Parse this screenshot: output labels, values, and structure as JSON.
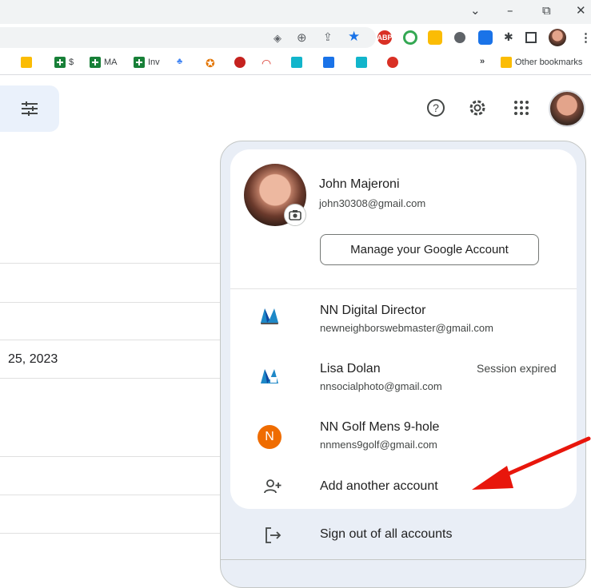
{
  "browser": {
    "window_controls": [
      "⌄",
      "–",
      "⧉",
      "✕"
    ],
    "extensions": [
      {
        "icon": "eye-icon",
        "color": "#5f6368"
      },
      {
        "icon": "zoom-icon",
        "color": "#5f6368"
      },
      {
        "icon": "share-icon",
        "color": "#5f6368"
      },
      {
        "icon": "star-icon",
        "color": "#1a73e8"
      },
      {
        "icon": "abp-extension-icon",
        "color": "#d93025",
        "label": "ABP"
      },
      {
        "icon": "compass-extension-icon",
        "color": "#34a853"
      },
      {
        "icon": "keep-extension-icon",
        "color": "#fbbc04"
      },
      {
        "icon": "settings-extension-icon",
        "color": "#5f6368"
      },
      {
        "icon": "screen-extension-icon",
        "color": "#1a73e8"
      },
      {
        "icon": "puzzle-icon",
        "color": "#3c4043"
      },
      {
        "icon": "sidepanel-icon",
        "color": "#3c4043"
      },
      {
        "icon": "profile-icon",
        "color": "#8b4a3c"
      },
      {
        "icon": "menu-icon",
        "color": "#3c4043"
      }
    ],
    "bookmarks": [
      {
        "label": "",
        "icon": "keep-bookmark-icon",
        "color": "#fbbc04"
      },
      {
        "label": "$",
        "icon": "sheets-icon",
        "color": "#188038"
      },
      {
        "label": "MA",
        "icon": "sheets-icon",
        "color": "#188038"
      },
      {
        "label": "Inv",
        "icon": "sheets-icon",
        "color": "#188038"
      },
      {
        "label": "",
        "icon": "photos-icon",
        "color": "#4285f4"
      },
      {
        "label": "",
        "icon": "medal-icon",
        "color": "#e37400"
      },
      {
        "label": "",
        "icon": "u-icon",
        "color": "#c5221f"
      },
      {
        "label": "",
        "icon": "gauge-icon",
        "color": "#d93025"
      },
      {
        "label": "",
        "icon": "home-icon",
        "color": "#12b5cb"
      },
      {
        "label": "",
        "icon": "check-icon",
        "color": "#1a73e8"
      },
      {
        "label": "",
        "icon": "magnet-icon",
        "color": "#12b5cb"
      },
      {
        "label": "",
        "icon": "alert-icon",
        "color": "#d93025"
      }
    ],
    "more_bookmarks": "»",
    "other_bookmarks": "Other bookmarks"
  },
  "background": {
    "date_fragment": "25, 2023"
  },
  "account_panel": {
    "name": "John Majeroni",
    "email": "john30308@gmail.com",
    "manage_button": "Manage your Google Account",
    "accounts": [
      {
        "name": "NN Digital Director",
        "email": "newneighborswebmaster@gmail.com",
        "status": "",
        "avatar": "nn-logo"
      },
      {
        "name": "Lisa Dolan",
        "email": "nnsocialphoto@gmail.com",
        "status": "Session expired",
        "avatar": "nn-logo"
      },
      {
        "name": "NN Golf Mens 9-hole",
        "email": "nnmens9golf@gmail.com",
        "status": "",
        "avatar": "letter",
        "letter": "N"
      }
    ],
    "add_account": "Add another account",
    "sign_out": "Sign out of all accounts"
  }
}
